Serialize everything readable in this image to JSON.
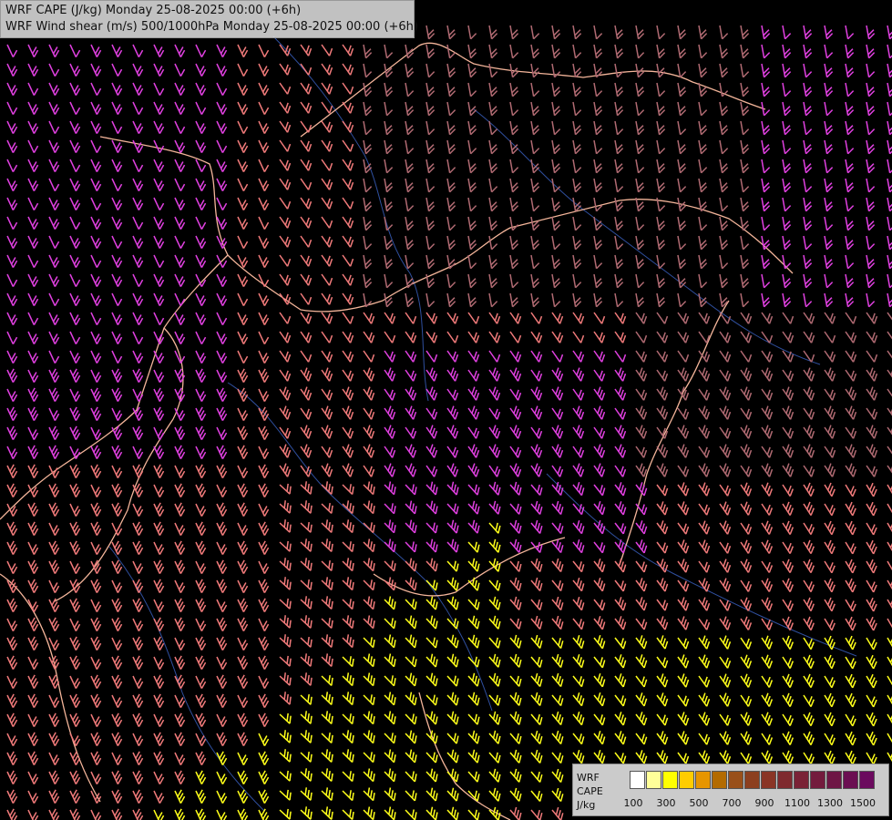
{
  "titles": {
    "line1": "WRF CAPE (J/kg) Monday 25-08-2025 00:00 (+6h)",
    "line2": "WRF Wind shear (m/s) 500/1000hPa Monday 25-08-2025 00:00 (+6h)"
  },
  "legend": {
    "label_model": "WRF",
    "label_field": "CAPE",
    "label_unit": "J/kg",
    "colors": [
      "#ffffff",
      "#ffff99",
      "#ffff00",
      "#ffcc00",
      "#e69500",
      "#b36b00",
      "#99501a",
      "#8c3f1f",
      "#8a3526",
      "#7f2a2f",
      "#7a2236",
      "#731b3d",
      "#6e1645",
      "#6b0f52",
      "#6b0a5e"
    ],
    "ticks": [
      "100",
      "300",
      "500",
      "700",
      "900",
      "1100",
      "1300",
      "1500"
    ]
  },
  "map": {
    "background": "#000000",
    "border_color": "#f4b59a",
    "river_color": "#2f4f9e",
    "barb_colors": {
      "weak": "#b06a72",
      "moderate": "#f07a7a",
      "strong": "#e040e0",
      "very_strong": "#ffff1a"
    }
  }
}
